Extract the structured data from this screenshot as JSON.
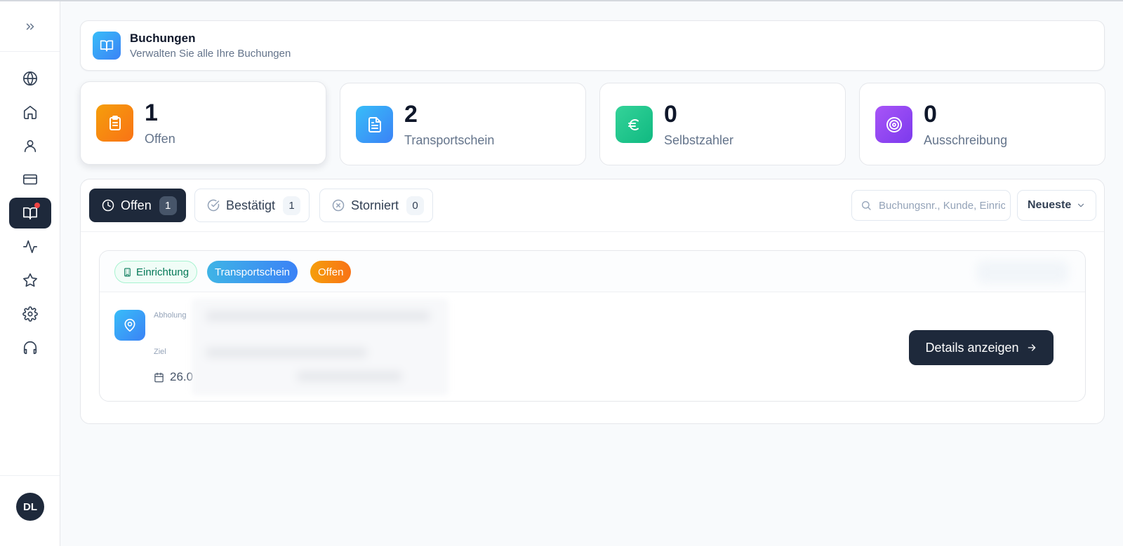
{
  "header": {
    "title": "Buchungen",
    "subtitle": "Verwalten Sie alle Ihre Buchungen"
  },
  "sidebar": {
    "items": [
      {
        "icon": "globe-icon"
      },
      {
        "icon": "home-icon"
      },
      {
        "icon": "user-icon"
      },
      {
        "icon": "credit-card-icon"
      },
      {
        "icon": "book-open-icon",
        "active": true
      },
      {
        "icon": "activity-icon"
      },
      {
        "icon": "star-icon"
      },
      {
        "icon": "settings-icon"
      },
      {
        "icon": "headset-icon"
      }
    ],
    "user_initials": "DL"
  },
  "stats": [
    {
      "value": "1",
      "label": "Offen",
      "icon": "clipboard-icon",
      "color": "#f59e0b"
    },
    {
      "value": "2",
      "label": "Transportschein",
      "icon": "file-text-icon",
      "color": "#3b82f6"
    },
    {
      "value": "0",
      "label": "Selbstzahler",
      "icon": "euro-icon",
      "color": "#10b981"
    },
    {
      "value": "0",
      "label": "Ausschreibung",
      "icon": "target-icon",
      "color": "#8b5cf6"
    }
  ],
  "tabs": [
    {
      "label": "Offen",
      "count": "1",
      "icon": "clock-icon",
      "active": true
    },
    {
      "label": "Bestätigt",
      "count": "1",
      "icon": "check-circle-icon"
    },
    {
      "label": "Storniert",
      "count": "0",
      "icon": "x-circle-icon"
    }
  ],
  "search": {
    "placeholder": "Buchungsnr., Kunde, Einrichtung",
    "value": ""
  },
  "sort": {
    "selected": "Neueste"
  },
  "booking": {
    "tags": [
      "Einrichtung",
      "Transportschein",
      "Offen"
    ],
    "pickup_label": "Abholung",
    "destination_label": "Ziel",
    "date_partial": "26.0",
    "details_label": "Details anzeigen"
  },
  "colors": {
    "dark": "#1e293b",
    "accent_blue": "#3b82f6",
    "accent_orange": "#f97316",
    "accent_green": "#10b981",
    "accent_purple": "#8b5cf6",
    "notification": "#ef4444"
  }
}
